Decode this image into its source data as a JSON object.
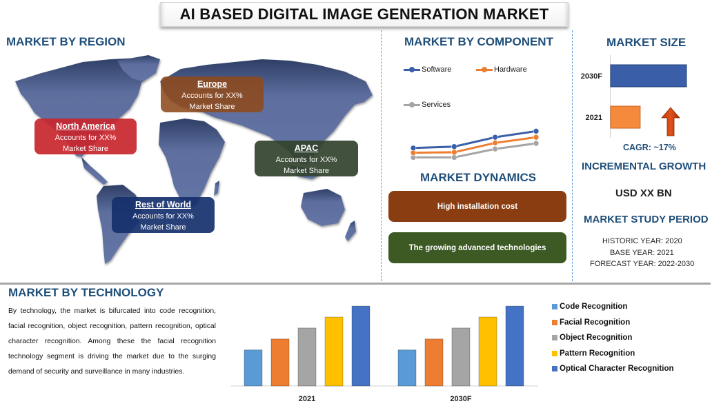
{
  "title": "AI BASED DIGITAL IMAGE GENERATION MARKET",
  "region": {
    "heading": "MARKET BY REGION",
    "map_icon": "world-map",
    "boxes": [
      {
        "name": "North America",
        "line1": "Accounts for XX%",
        "line2": "Market Share",
        "color": "#c8252c"
      },
      {
        "name": "Europe",
        "line1": "Accounts for XX%",
        "line2": "Market Share",
        "color": "#8e4a1c"
      },
      {
        "name": "APAC",
        "line1": "Accounts for XX%",
        "line2": "Market Share",
        "color": "#3a4a30"
      },
      {
        "name": "Rest of World",
        "line1": "Accounts for XX%",
        "line2": "Market Share",
        "color": "#1c3570"
      }
    ]
  },
  "component": {
    "heading": "MARKET BY COMPONENT",
    "legend": [
      "Software",
      "Hardware",
      "Services"
    ]
  },
  "dynamics": {
    "heading": "MARKET DYNAMICS",
    "items": [
      {
        "label": "High installation cost",
        "color": "#8b3d12"
      },
      {
        "label": "The growing advanced technologies",
        "color": "#3d5a24"
      }
    ]
  },
  "market_size": {
    "heading": "MARKET SIZE",
    "cagr_label": "CAGR:  ~17%",
    "arrow_icon": "up-arrow",
    "incremental_heading": "INCREMENTAL GROWTH",
    "incremental_value": "USD XX BN",
    "study_heading": "MARKET STUDY PERIOD",
    "historic": "HISTORIC YEAR: 2020",
    "base": "BASE YEAR: 2021",
    "forecast": "FORECAST YEAR: 2022-2030"
  },
  "technology": {
    "heading": "MARKET BY TECHNOLOGY",
    "paragraph": "By technology, the market is bifurcated into code recognition, facial recognition, object recognition, pattern recognition, optical character recognition. Among these the facial recognition technology segment is driving the market due to the surging demand of security and surveillance in many industries."
  },
  "colors": {
    "heading": "#1f4e79",
    "divider": "#5b9bd5"
  },
  "chart_data": [
    {
      "id": "component",
      "type": "line",
      "title": "MARKET BY COMPONENT",
      "x": [
        "P1",
        "P2",
        "P3",
        "P4"
      ],
      "axis_labels_visible": false,
      "legend_position": "top",
      "ylim": [
        0,
        10
      ],
      "series": [
        {
          "name": "Software",
          "color": "#3a5fa8",
          "values": [
            4.0,
            4.3,
            6.3,
            7.6
          ]
        },
        {
          "name": "Hardware",
          "color": "#ed7d31",
          "values": [
            3.0,
            3.1,
            5.1,
            6.3
          ]
        },
        {
          "name": "Services",
          "color": "#a5a5a5",
          "values": [
            2.0,
            2.0,
            3.8,
            5.0
          ]
        }
      ]
    },
    {
      "id": "market-size",
      "type": "bar",
      "orientation": "horizontal",
      "title": "MARKET SIZE",
      "categories": [
        "2030F",
        "2021"
      ],
      "values": [
        100,
        39
      ],
      "colors": [
        "#3a5fa8",
        "#f58a3c"
      ],
      "value_units": "relative",
      "xlim": [
        0,
        100
      ]
    },
    {
      "id": "technology",
      "type": "bar",
      "title": "MARKET BY TECHNOLOGY",
      "categories": [
        "2021",
        "2030F"
      ],
      "legend_position": "right",
      "ylim": [
        0,
        110
      ],
      "series": [
        {
          "name": "Code Recognition",
          "color": "#5b9bd5",
          "values": [
            46,
            46
          ]
        },
        {
          "name": "Facial Recognition",
          "color": "#ed7d31",
          "values": [
            60,
            60
          ]
        },
        {
          "name": "Object Recognition",
          "color": "#a5a5a5",
          "values": [
            74,
            74
          ]
        },
        {
          "name": "Pattern Recognition",
          "color": "#ffc000",
          "values": [
            88,
            88
          ]
        },
        {
          "name": "Optical Character Recognition",
          "color": "#4472c4",
          "values": [
            102,
            102
          ]
        }
      ]
    }
  ]
}
